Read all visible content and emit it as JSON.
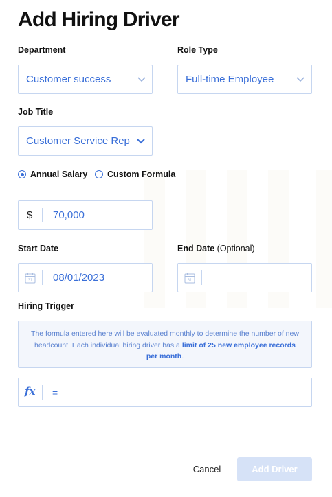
{
  "header": {
    "title": "Add Hiring Driver"
  },
  "department": {
    "label": "Department",
    "value": "Customer success"
  },
  "role_type": {
    "label": "Role Type",
    "value": "Full-time Employee"
  },
  "job_title": {
    "label": "Job Title",
    "value": "Customer Service Rep"
  },
  "salary_mode": {
    "options": [
      {
        "label": "Annual Salary",
        "selected": true
      },
      {
        "label": "Custom Formula",
        "selected": false
      }
    ]
  },
  "salary": {
    "currency": "$",
    "value": "70,000"
  },
  "start_date": {
    "label": "Start Date",
    "value": "08/01/2023"
  },
  "end_date": {
    "label": "End Date",
    "optional": "(Optional)",
    "value": ""
  },
  "hiring_trigger": {
    "label": "Hiring Trigger",
    "info_text": "The formula entered here will be evaluated monthly to determine the number of new headcount. Each individual hiring driver has a",
    "info_bold": "limit of 25 new employee records per month",
    "info_end": ".",
    "fx_symbol": "fx",
    "formula": "="
  },
  "footer": {
    "cancel_label": "Cancel",
    "submit_label": "Add Driver"
  },
  "colors": {
    "accent": "#3a6fd8",
    "border": "#c6d6f0",
    "disabled_button": "#d6e2f7"
  },
  "icons": {
    "dropdown": "chevron-down-icon",
    "date": "calendar-icon",
    "formula": "fx-icon"
  }
}
